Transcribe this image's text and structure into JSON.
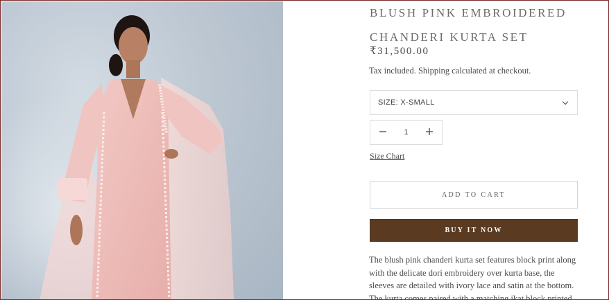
{
  "product": {
    "title_line1": "BLUSH PINK EMBROIDERED",
    "title_line2": "CHANDERI KURTA SET",
    "price": "₹31,500.00",
    "tax_note": "Tax included. Shipping calculated at checkout.",
    "image_alt": "Model wearing blush pink embroidered chanderi kurta set with sheer dupatta"
  },
  "size_selector": {
    "selected_label": "SIZE: X-SMALL",
    "icon": "chevron-down-icon"
  },
  "quantity": {
    "value": "1",
    "decrease_icon": "minus-icon",
    "increase_icon": "plus-icon"
  },
  "links": {
    "size_chart": "Size Chart"
  },
  "buttons": {
    "add_to_cart": "ADD TO CART",
    "buy_now": "BUY IT NOW"
  },
  "description": {
    "text": "The blush pink chanderi kurta set features block print along with the delicate dori embroidery over kurta base, the sleeves are detailed with ivory lace and satin at the bottom. The kurta comes paired with a matching ikat block printed"
  },
  "colors": {
    "buy_now_bg": "#5a3a20",
    "title": "#6e6a66",
    "border": "#dcdcdc"
  }
}
